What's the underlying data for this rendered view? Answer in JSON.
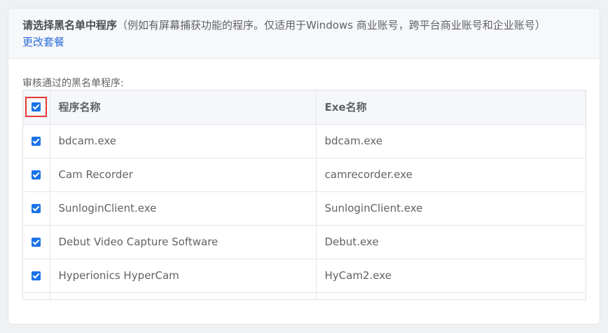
{
  "header": {
    "title": "请选择黑名单中程序",
    "note": "（例如有屏幕捕获功能的程序。仅适用于Windows 商业账号，跨平台商业账号和企业账号）",
    "change_plan_link": "更改套餐"
  },
  "section_label": "审核通过的黑名单程序:",
  "table": {
    "select_all_checked": true,
    "columns": [
      "程序名称",
      "Exe名称"
    ],
    "rows": [
      {
        "name": "bdcam.exe",
        "exe": "bdcam.exe",
        "checked": true
      },
      {
        "name": "Cam Recorder",
        "exe": "camrecorder.exe",
        "checked": true
      },
      {
        "name": "SunloginClient.exe",
        "exe": "SunloginClient.exe",
        "checked": true
      },
      {
        "name": "Debut Video Capture Software",
        "exe": "Debut.exe",
        "checked": true
      },
      {
        "name": "Hyperionics HyperCam",
        "exe": "HyCam2.exe",
        "checked": true
      }
    ]
  },
  "colors": {
    "accent": "#1a73e8",
    "link": "#2e6fd8",
    "highlight_border": "#e53935"
  }
}
